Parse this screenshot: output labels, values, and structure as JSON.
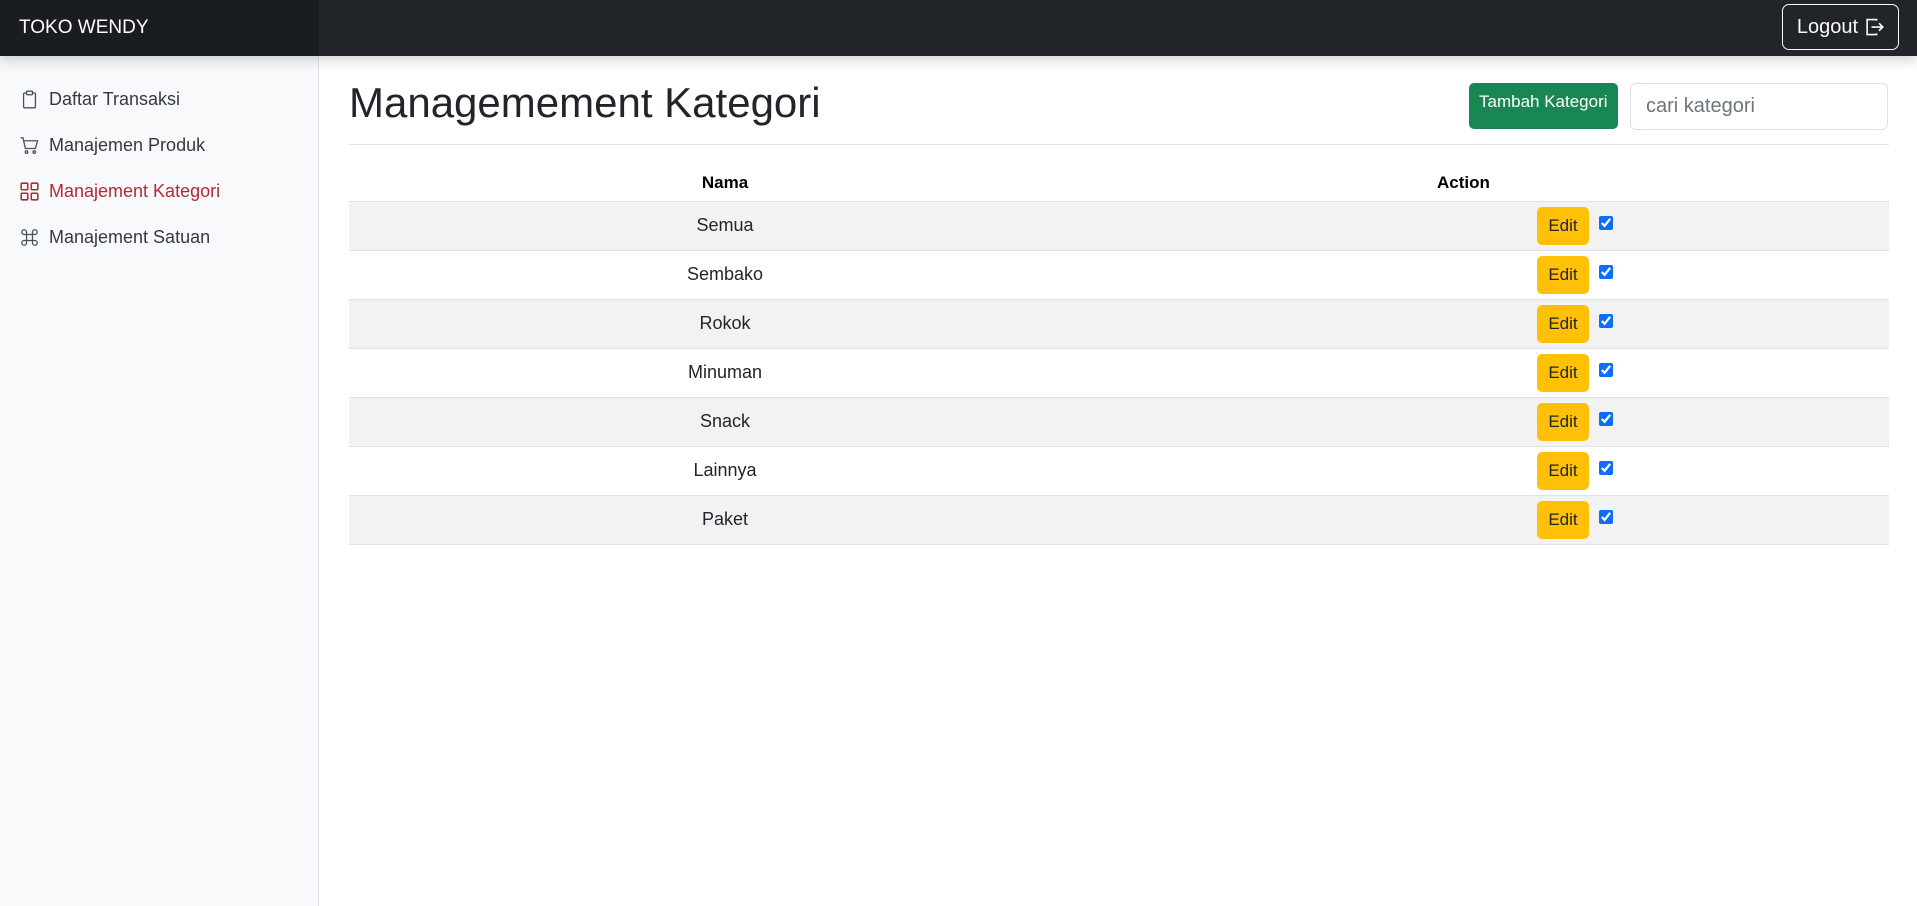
{
  "app": {
    "brand": "TOKO WENDY",
    "logout_label": "Logout"
  },
  "sidebar": {
    "items": [
      {
        "label": "Daftar Transaksi",
        "icon": "clipboard-icon",
        "active": false
      },
      {
        "label": "Manajemen Produk",
        "icon": "cart-icon",
        "active": false
      },
      {
        "label": "Manajement Kategori",
        "icon": "grid-icon",
        "active": true
      },
      {
        "label": "Manajement Satuan",
        "icon": "command-icon",
        "active": false
      }
    ]
  },
  "main": {
    "title": "Managemement Kategori",
    "add_button": "Tambah Kategori",
    "search_placeholder": "cari kategori",
    "table": {
      "headers": {
        "name": "Nama",
        "action": "Action"
      },
      "edit_label": "Edit",
      "rows": [
        {
          "name": "Semua",
          "checked": true
        },
        {
          "name": "Sembako",
          "checked": true
        },
        {
          "name": "Rokok",
          "checked": true
        },
        {
          "name": "Minuman",
          "checked": true
        },
        {
          "name": "Snack",
          "checked": true
        },
        {
          "name": "Lainnya",
          "checked": true
        },
        {
          "name": "Paket",
          "checked": true
        }
      ]
    }
  },
  "colors": {
    "navbar": "#212529",
    "active": "#b02a37",
    "add": "#198754",
    "edit": "#ffc107",
    "checkbox": "#0d6efd"
  }
}
